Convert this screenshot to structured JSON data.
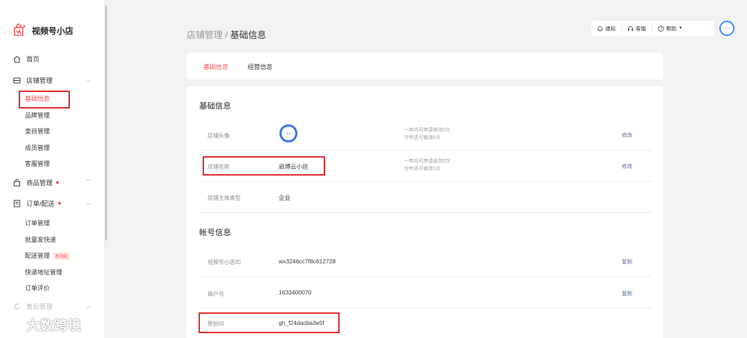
{
  "brand": {
    "name": "视频号小店"
  },
  "sidebar": {
    "home": "首页",
    "store_mgmt": "店铺管理",
    "store_sub": [
      "基础信息",
      "品牌管理",
      "类目管理",
      "成员管理",
      "客服管理"
    ],
    "product_mgmt": "商品管理",
    "order_mgmt": "订单/配送",
    "order_sub": [
      "订单管理",
      "批量发快递",
      "配送管理",
      "快递地址管理",
      "订单评价"
    ],
    "new_badge": "新功能",
    "after_sale": "售后管理"
  },
  "header": {
    "breadcrumb_parent": "店铺管理",
    "breadcrumb_sep": " / ",
    "breadcrumb_current": "基础信息",
    "notify": "通知",
    "service": "客服",
    "help": "帮助"
  },
  "tabs": [
    "基础信息",
    "经营信息"
  ],
  "basic": {
    "title": "基础信息",
    "rows": [
      {
        "label": "店铺头像",
        "note1": "一年内可申请修改5次",
        "note2": "今年还可修改5次",
        "action": "修改"
      },
      {
        "label": "店铺名称",
        "value": "启博云小店",
        "note1": "一年内可申请修改5次",
        "note2": "今年还可修改5次",
        "action": "修改"
      },
      {
        "label": "店铺主体类型",
        "value": "企业"
      }
    ]
  },
  "account": {
    "title": "帐号信息",
    "rows": [
      {
        "label": "视频号小店ID",
        "value": "wx3246cc7f8c612728",
        "action": "复制"
      },
      {
        "label": "商户号",
        "value": "1633400070",
        "action": "复制"
      },
      {
        "label": "原始ID",
        "value": "gh_f24dacba3e5f"
      }
    ]
  },
  "watermark": "大数跨境",
  "colors": {
    "accent": "#fa5151",
    "link": "#576b95",
    "highlight": "#e02020"
  }
}
